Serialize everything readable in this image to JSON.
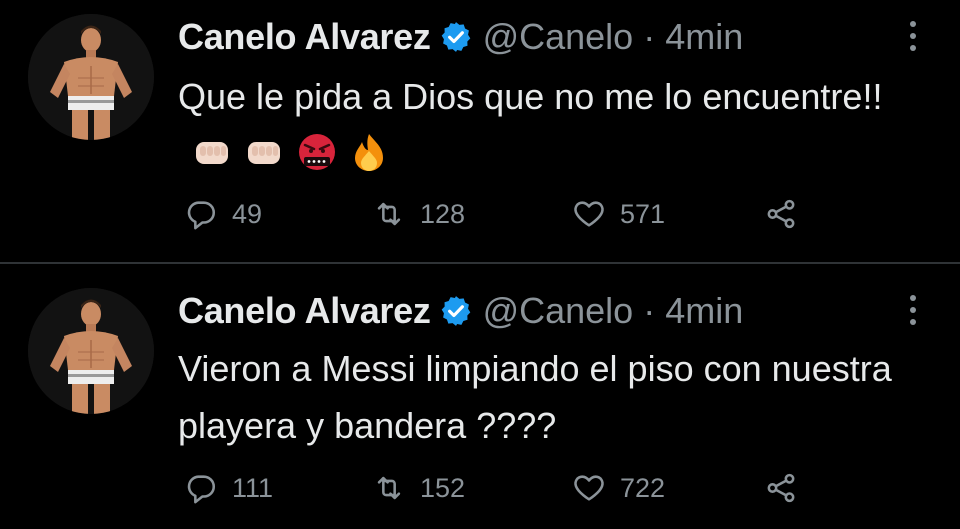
{
  "tweets": [
    {
      "author_name": "Canelo Alvarez",
      "handle": "@Canelo",
      "separator": "·",
      "time": "4min",
      "text": "Que le pida a Dios que no me lo encuentre!!",
      "emoji_icons": [
        "fist-icon",
        "fist-icon",
        "angry-face-icon",
        "fire-icon"
      ],
      "replies": "49",
      "retweets": "128",
      "likes": "571"
    },
    {
      "author_name": "Canelo Alvarez",
      "handle": "@Canelo",
      "separator": "·",
      "time": "4min",
      "text": "Vieron a Messi limpiando el piso con nuestra playera y bandera ????",
      "replies": "111",
      "retweets": "152",
      "likes": "722"
    }
  ],
  "colors": {
    "background": "#000000",
    "text": "#e7e9ea",
    "secondary": "#8b9399",
    "verified": "#1d9bf0",
    "divider": "#2f3336"
  }
}
